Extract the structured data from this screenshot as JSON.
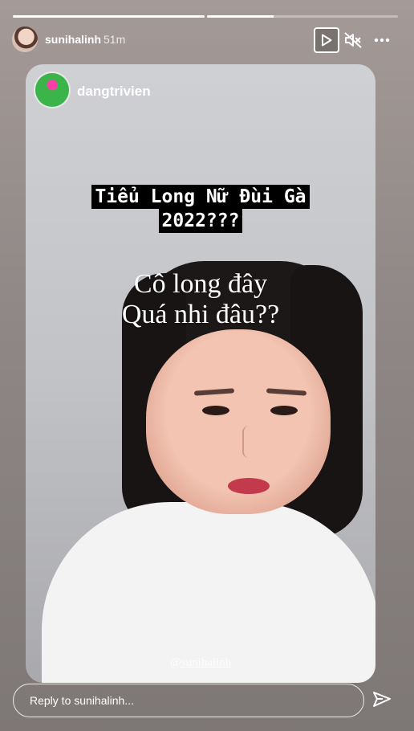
{
  "progress": {
    "segments": [
      1.0,
      0.35
    ]
  },
  "header": {
    "username": "sunihalinh",
    "time_ago": "51m",
    "play_icon": "play-icon",
    "mute_icon": "speaker-muted-icon",
    "more_icon": "more-horizontal-icon"
  },
  "shared_post": {
    "username": "dangtrivien",
    "caption_lines": [
      "Tiểu Long Nữ Đùi Gà",
      "2022???"
    ],
    "overlay_lines": [
      "Cô long đây",
      "Quá nhi đâu??"
    ],
    "mention": "@sunihalinh"
  },
  "reply": {
    "placeholder": "Reply to sunihalinh...",
    "send_icon": "send-icon"
  },
  "colors": {
    "accent": "#ffffff",
    "caption_bg": "#000000",
    "lip": "#c23a4b"
  }
}
